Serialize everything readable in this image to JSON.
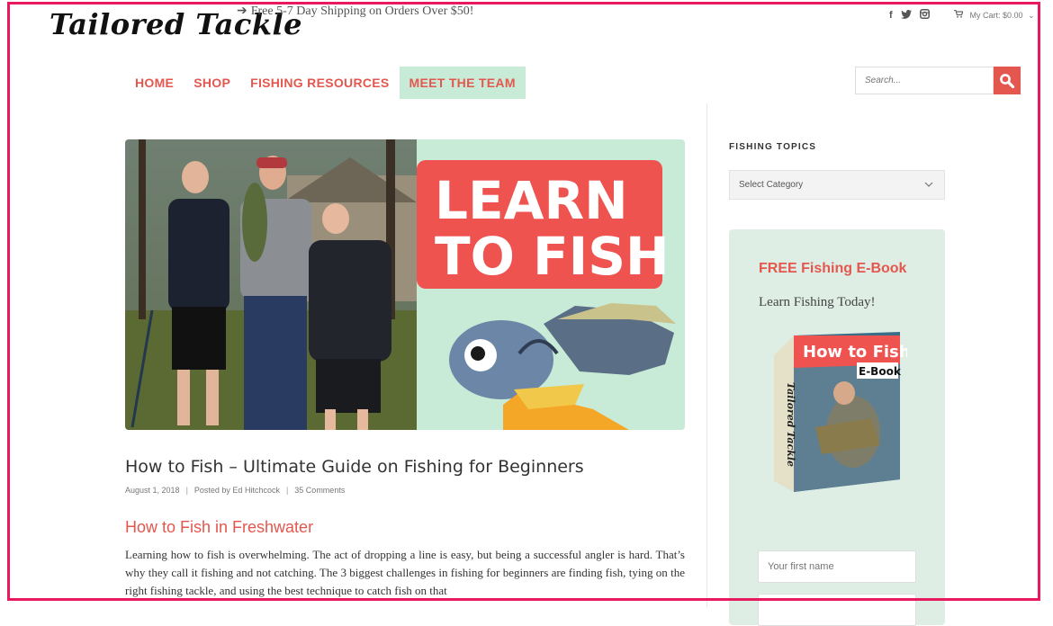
{
  "header": {
    "logo": "Tailored Tackle",
    "promo": "Free 5-7 Day Shipping on Orders Over $50!",
    "promo_arrow": "➔",
    "cart_label": "My Cart: $0.00",
    "social_icons": [
      "facebook-icon",
      "twitter-icon",
      "instagram-icon"
    ]
  },
  "nav": {
    "items": [
      "HOME",
      "SHOP",
      "FISHING RESOURCES",
      "MEET THE TEAM"
    ],
    "active": "MEET THE TEAM"
  },
  "search": {
    "placeholder": "Search..."
  },
  "hero": {
    "banner_line1": "LEARN",
    "banner_line2": "TO FISH"
  },
  "post": {
    "title": "How to Fish – Ultimate Guide on Fishing for Beginners",
    "date": "August 1, 2018",
    "author": "Posted by Ed Hitchcock",
    "comments": "35 Comments",
    "section_heading": "How to Fish in Freshwater",
    "body": "Learning how to fish is overwhelming. The act of dropping a line is easy, but being a successful angler is hard. That’s why they call it fishing and not catching. The 3 biggest challenges in fishing for beginners are finding fish, tying on the right fishing tackle, and using the best technique to catch fish on that"
  },
  "sidebar": {
    "heading": "FISHING TOPICS",
    "select_value": "Select Category",
    "ebook": {
      "title": "FREE Fishing E-Book",
      "subtitle": "Learn Fishing Today!",
      "cover_title": "How to Fish",
      "cover_subtitle": "E-Book",
      "cover_spine": "Tailored Tackle",
      "first_name_placeholder": "Your first name"
    }
  },
  "colors": {
    "accent": "#e4574f",
    "nav_active_bg": "#c7ebd7",
    "ebook_bg": "#deeee5",
    "frame": "#e8195f"
  }
}
